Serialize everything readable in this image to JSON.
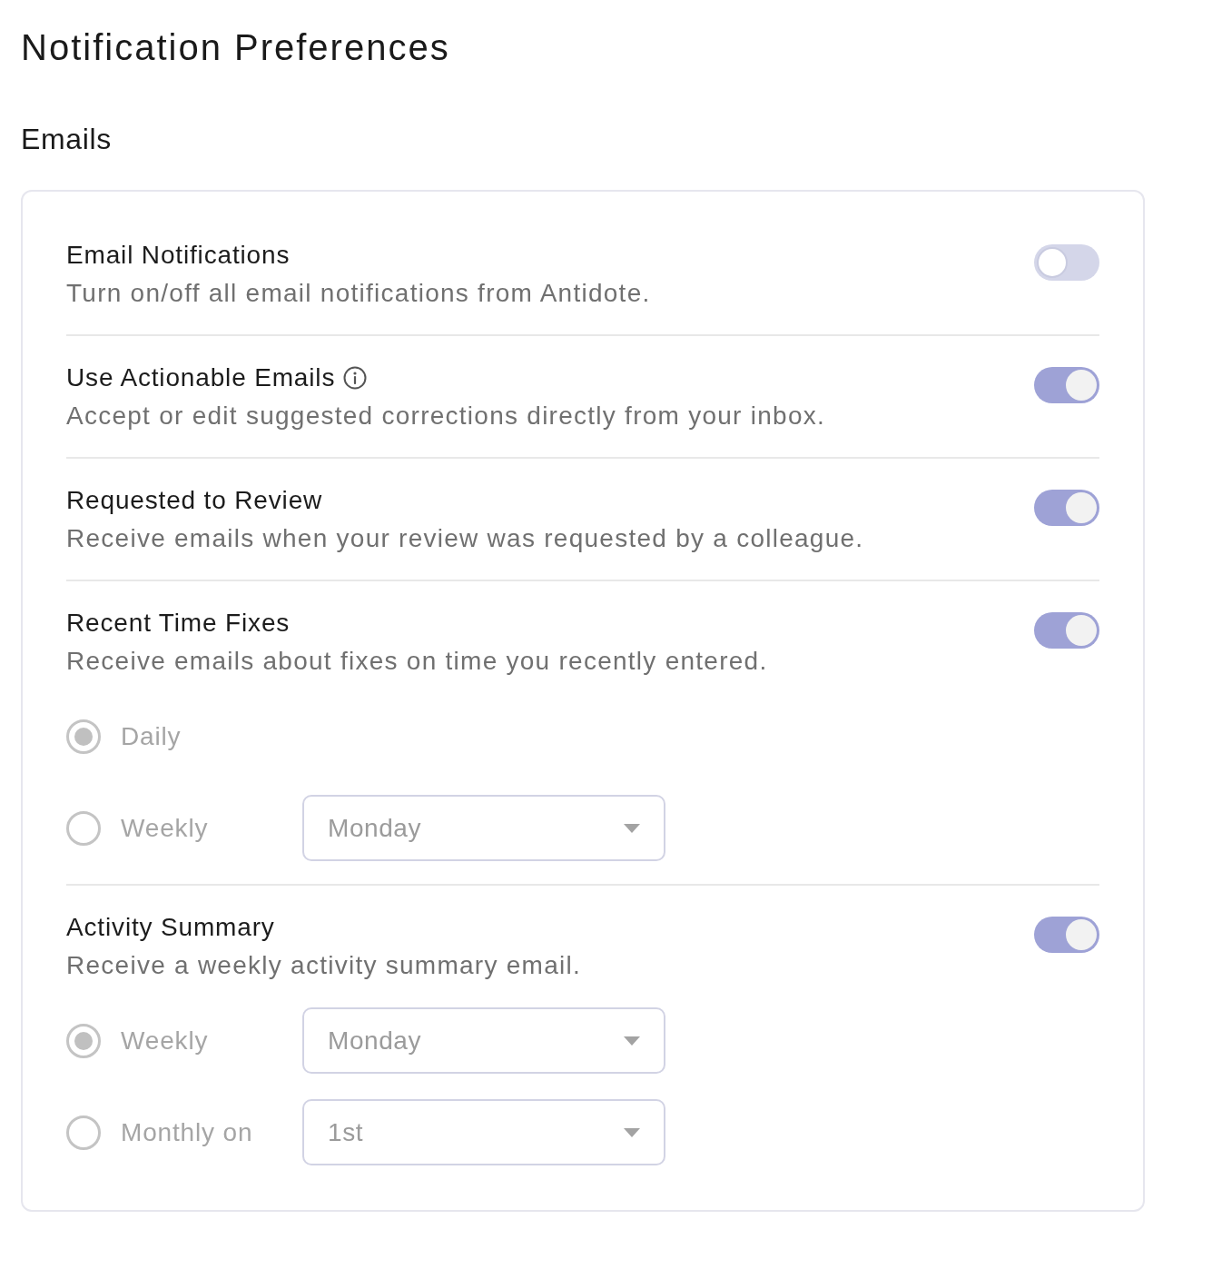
{
  "page": {
    "title": "Notification Preferences"
  },
  "section": {
    "title": "Emails"
  },
  "settings": [
    {
      "title": "Email Notifications",
      "description": "Turn on/off all email notifications from Antidote.",
      "on": false
    },
    {
      "title": "Use Actionable Emails",
      "info": true,
      "description": "Accept or edit suggested corrections directly from your inbox.",
      "on": true
    },
    {
      "title": "Requested to Review",
      "description": "Receive emails when your review was requested by a colleague.",
      "on": true
    },
    {
      "title": "Recent Time Fixes",
      "description": "Receive emails about fixes on time you recently entered.",
      "on": true,
      "options": [
        {
          "label": "Daily",
          "selected": true
        },
        {
          "label": "Weekly",
          "selected": false,
          "dropdown": "Monday"
        }
      ]
    },
    {
      "title": "Activity Summary",
      "description": "Receive a weekly activity summary email.",
      "on": true,
      "options": [
        {
          "label": "Weekly",
          "selected": true,
          "dropdown": "Monday"
        },
        {
          "label": "Monthly on",
          "selected": false,
          "dropdown": "1st"
        }
      ]
    }
  ]
}
